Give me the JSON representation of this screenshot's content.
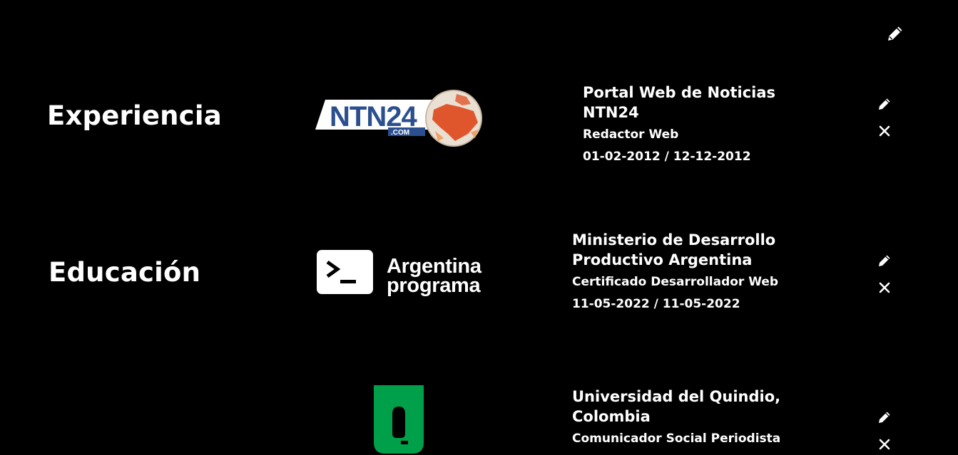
{
  "header": {
    "edit_icon": "pencil-icon"
  },
  "sections": {
    "experience_title": "Experiencia",
    "education_title": "Educación"
  },
  "experience": [
    {
      "logo_text": "NTN24",
      "logo_subtext": ".COM",
      "name": "Portal Web de Noticias NTN24",
      "role": "Redactor Web",
      "dates": "01-02-2012 / 12-12-2012",
      "edit_icon": "pencil-icon",
      "delete_icon": "close-icon"
    }
  ],
  "education": [
    {
      "logo_text_line1": "Argentina",
      "logo_text_line2": "programa",
      "name": "Ministerio de Desarrollo Productivo Argentina",
      "role": "Certificado Desarrollador Web",
      "dates": "11-05-2022 / 11-05-2022",
      "edit_icon": "pencil-icon",
      "delete_icon": "close-icon"
    },
    {
      "name": "Universidad del Quindio, Colombia",
      "role": "Comunicador Social Periodista",
      "edit_icon": "pencil-icon",
      "delete_icon": "close-icon"
    }
  ],
  "colors": {
    "background": "#000000",
    "text": "#ffffff",
    "ntn_blue": "#2b4f8f",
    "ntn_orange": "#e0562c",
    "uniquindio_green": "#00a04a"
  }
}
